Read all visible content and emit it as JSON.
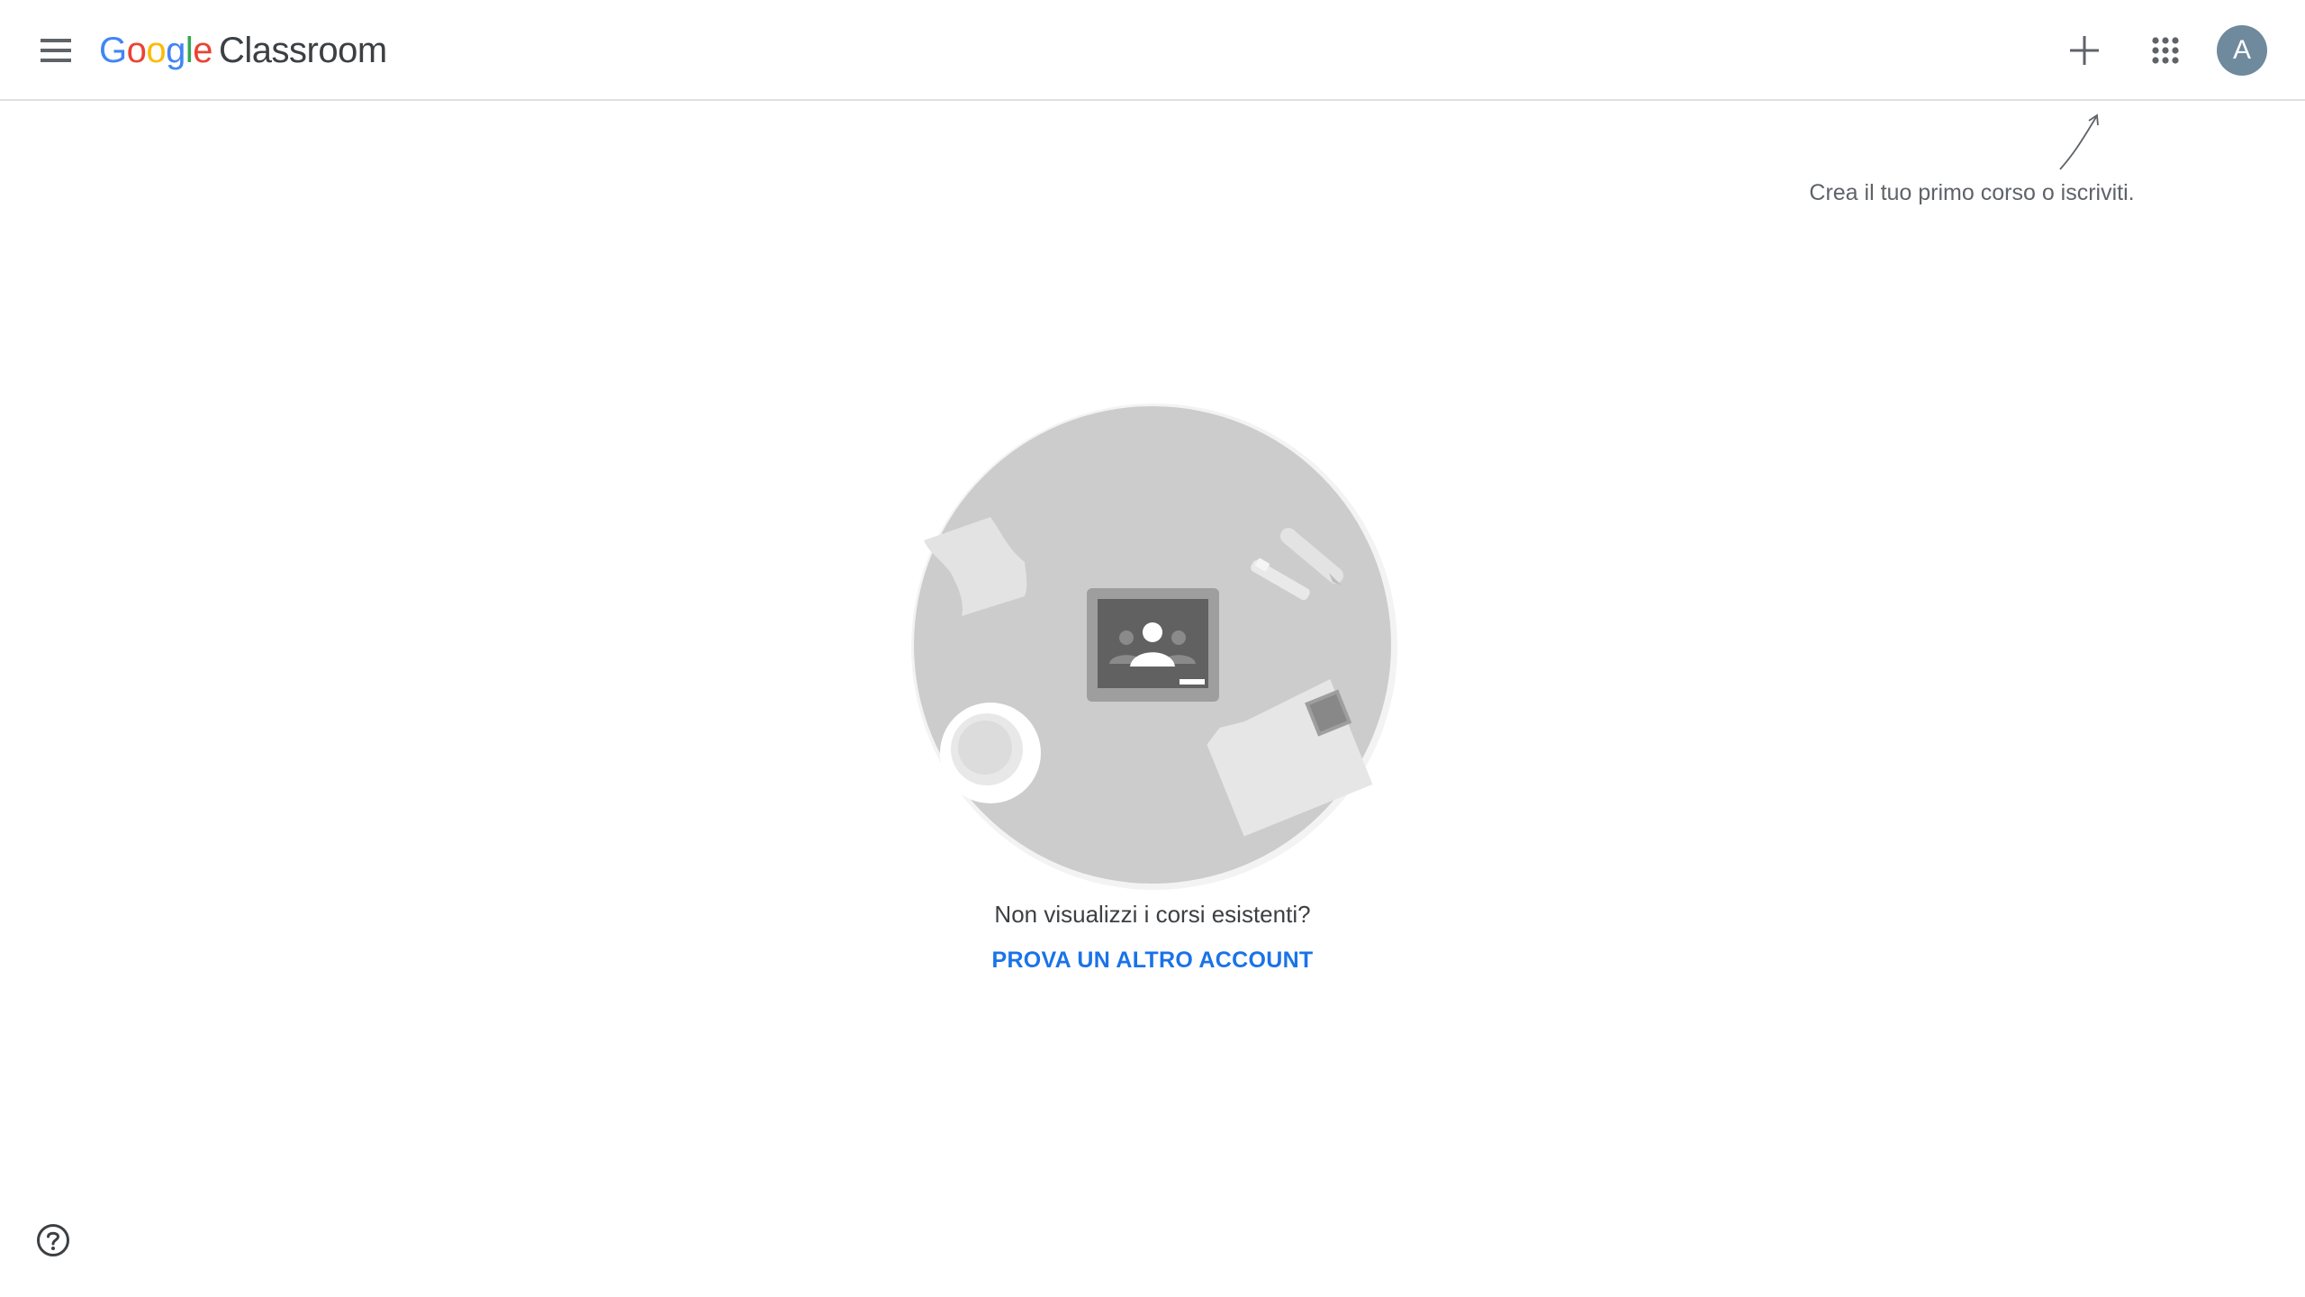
{
  "app": {
    "logo_google": [
      "G",
      "o",
      "o",
      "g",
      "l",
      "e"
    ],
    "logo_product": "Classroom"
  },
  "header": {
    "menu_icon": "hamburger-menu-icon",
    "add_icon": "plus-icon",
    "apps_icon": "apps-grid-icon",
    "avatar_initial": "A",
    "avatar_color": "#6f8a9c"
  },
  "hint": {
    "text": "Crea il tuo primo corso o iscriviti."
  },
  "empty_state": {
    "title": "Non visualizzi i corsi esistenti?",
    "action_label": "PROVA UN ALTRO ACCOUNT",
    "action_color": "#1a73e8"
  },
  "footer": {
    "help_icon": "help-circle-icon"
  }
}
